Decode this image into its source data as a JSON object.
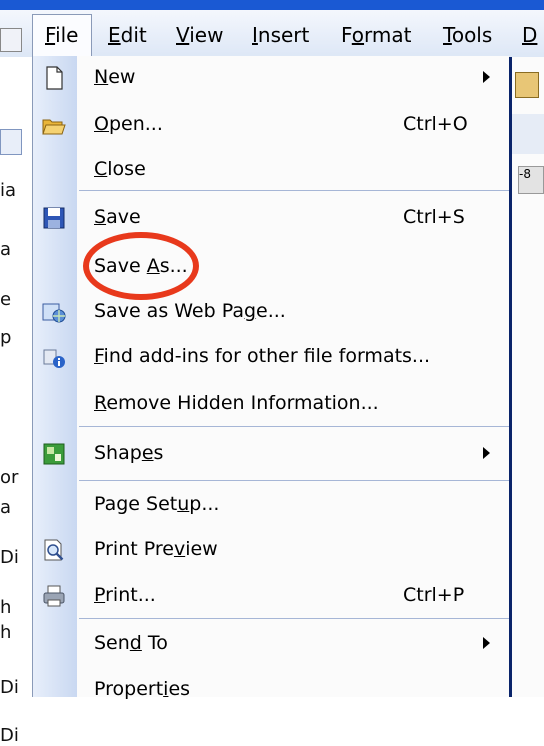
{
  "menubar": {
    "items": [
      {
        "label": "File",
        "access": "F"
      },
      {
        "label": "Edit",
        "access": "E"
      },
      {
        "label": "View",
        "access": "V"
      },
      {
        "label": "Insert",
        "access": "I"
      },
      {
        "label": "Format",
        "access": "o"
      },
      {
        "label": "Tools",
        "access": "T"
      },
      {
        "label": "D",
        "access": "D"
      }
    ]
  },
  "file_menu": {
    "items": [
      {
        "id": "new",
        "pre": "",
        "u": "N",
        "post": "ew",
        "shortcut": "",
        "submenu": true,
        "icon": "blank-page-icon"
      },
      {
        "id": "open",
        "pre": "",
        "u": "O",
        "post": "pen...",
        "shortcut": "Ctrl+O",
        "submenu": false,
        "icon": "open-folder-icon"
      },
      {
        "id": "close",
        "pre": "",
        "u": "C",
        "post": "lose",
        "shortcut": "",
        "submenu": false,
        "icon": ""
      },
      {
        "id": "save",
        "pre": "",
        "u": "S",
        "post": "ave",
        "shortcut": "Ctrl+S",
        "submenu": false,
        "icon": "floppy-disk-icon"
      },
      {
        "id": "save-as",
        "pre": "Save ",
        "u": "A",
        "post": "s...",
        "shortcut": "",
        "submenu": false,
        "icon": ""
      },
      {
        "id": "save-web",
        "pre": "Save as Web Pa",
        "u": "g",
        "post": "e...",
        "shortcut": "",
        "submenu": false,
        "icon": "web-page-icon"
      },
      {
        "id": "find-addins",
        "pre": "",
        "u": "F",
        "post": "ind add-ins for other file formats...",
        "shortcut": "",
        "submenu": false,
        "icon": "addin-info-icon"
      },
      {
        "id": "remove-hidden",
        "pre": "",
        "u": "R",
        "post": "emove Hidden Information...",
        "shortcut": "",
        "submenu": false,
        "icon": ""
      },
      {
        "id": "shapes",
        "pre": "Shap",
        "u": "e",
        "post": "s",
        "shortcut": "",
        "submenu": true,
        "icon": "shapes-icon"
      },
      {
        "id": "page-setup",
        "pre": "Page Set",
        "u": "u",
        "post": "p...",
        "shortcut": "",
        "submenu": false,
        "icon": ""
      },
      {
        "id": "print-preview",
        "pre": "Print Pre",
        "u": "v",
        "post": "iew",
        "shortcut": "",
        "submenu": false,
        "icon": "print-preview-icon"
      },
      {
        "id": "print",
        "pre": "",
        "u": "P",
        "post": "rint...",
        "shortcut": "Ctrl+P",
        "submenu": false,
        "icon": "printer-icon"
      },
      {
        "id": "send-to",
        "pre": "Sen",
        "u": "d",
        "post": " To",
        "shortcut": "",
        "submenu": true,
        "icon": ""
      },
      {
        "id": "properties",
        "pre": "Propert",
        "u": "i",
        "post": "es",
        "shortcut": "",
        "submenu": false,
        "icon": ""
      }
    ]
  },
  "background": {
    "left_fragments": [
      "ia",
      "a",
      "e",
      "p",
      "or",
      "a",
      "Di",
      "h",
      "h",
      "Di",
      "Di"
    ],
    "ruler_text": "-8"
  },
  "annotation": {
    "color": "#e8391c",
    "target": "save-as"
  }
}
